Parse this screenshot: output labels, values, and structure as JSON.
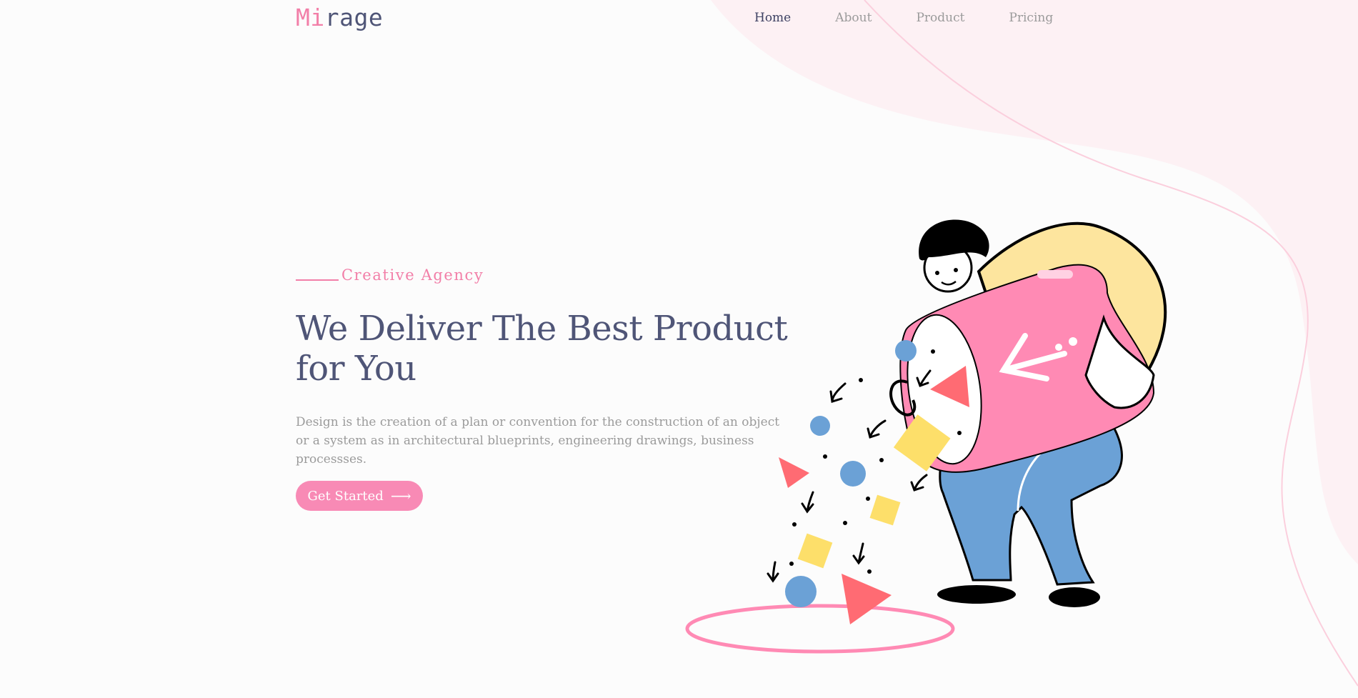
{
  "brand": {
    "logo_prefix": "Mi",
    "logo_suffix": "rage",
    "accent_color": "#f27fa8",
    "text_color": "#4f5577"
  },
  "nav": {
    "items": [
      {
        "label": "Home",
        "active": true
      },
      {
        "label": "About",
        "active": false
      },
      {
        "label": "Product",
        "active": false
      },
      {
        "label": "Pricing",
        "active": false
      }
    ]
  },
  "hero": {
    "eyebrow": "Creative Agency",
    "title": "We Deliver The Best Product for You",
    "description": "Design is the creation of a plan or convention for the construction of an object or a system as in architectural blueprints, engineering drawings, business processses.",
    "cta_label": "Get Started",
    "cta_icon": "arrow-right-icon",
    "cta_color": "#f88ab5"
  },
  "illustration": {
    "subject": "hero-illustration",
    "colors": {
      "pink": "#ff8ab4",
      "yellow": "#fde59e",
      "blue": "#6ba1d6",
      "red": "#ff6b73",
      "square_yellow": "#fddf6a"
    }
  }
}
